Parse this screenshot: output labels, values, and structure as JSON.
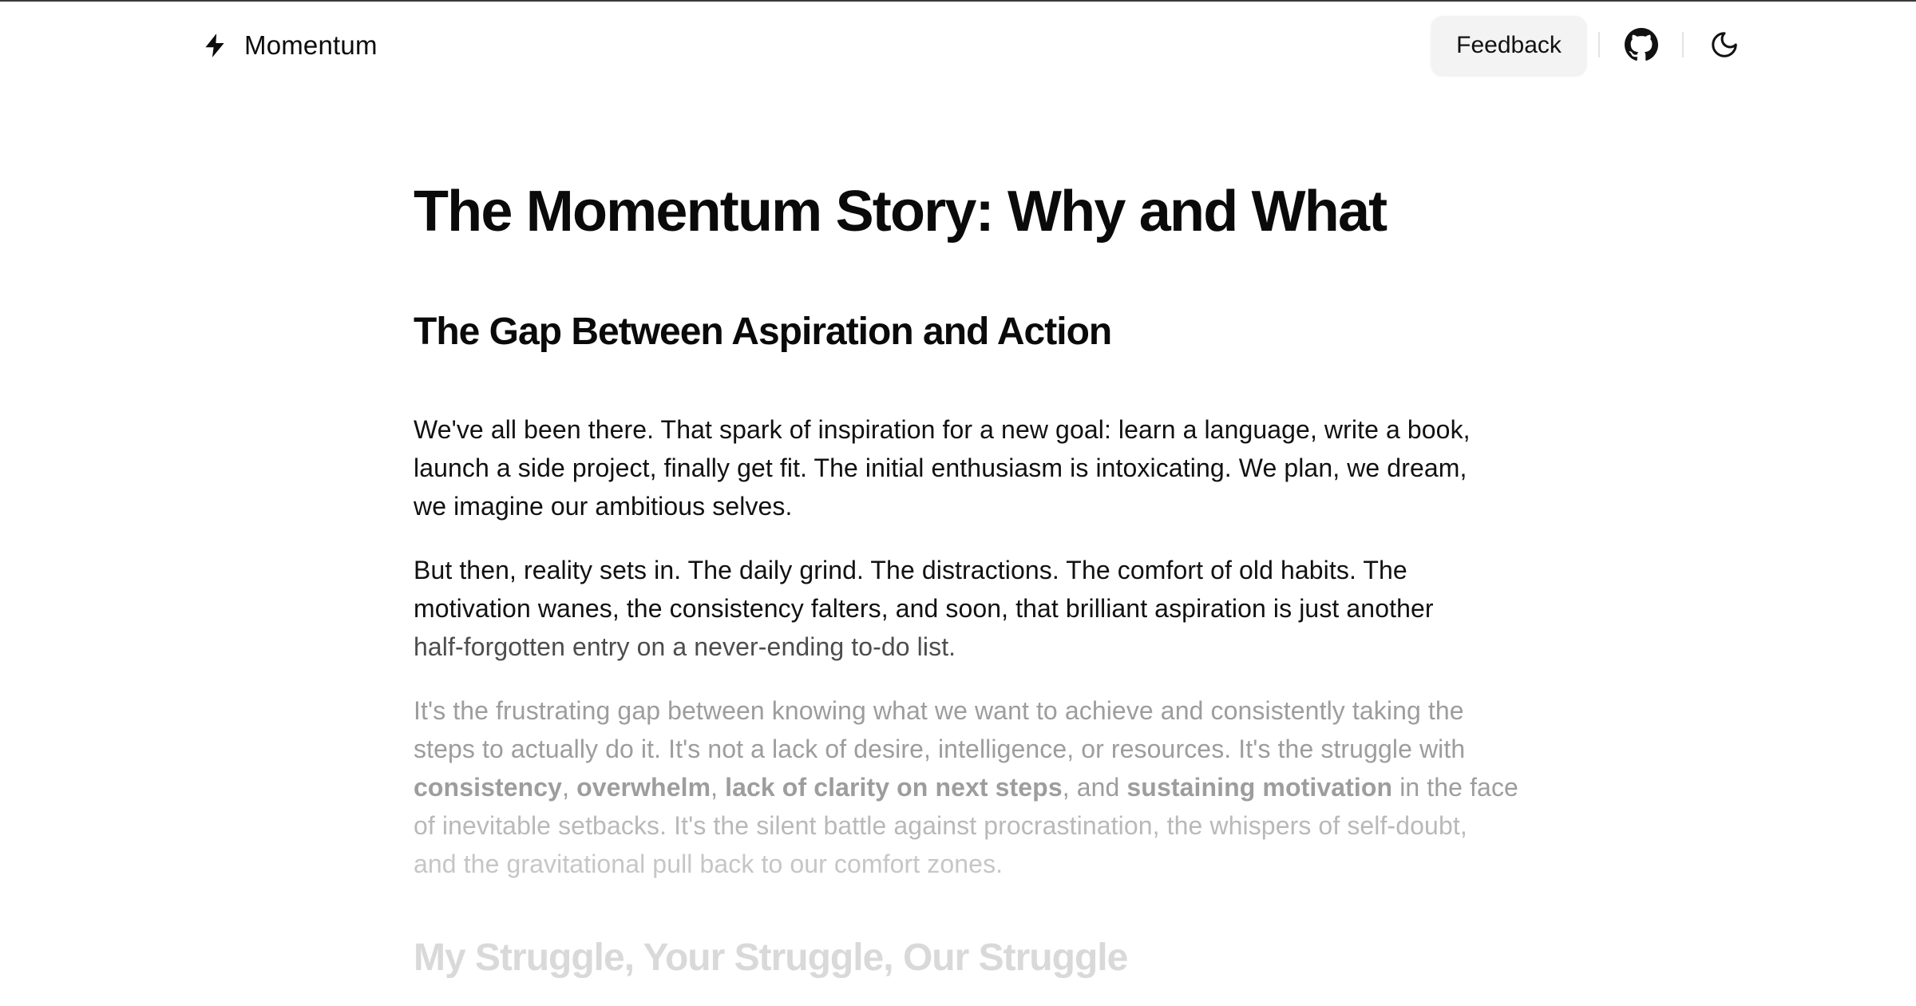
{
  "header": {
    "brand": {
      "name": "Momentum",
      "icon": "lightning-bolt-icon"
    },
    "feedback_label": "Feedback",
    "github_icon": "github-icon",
    "theme_icon": "moon-icon"
  },
  "article": {
    "title": "The Momentum Story: Why and What",
    "section1_heading": "The Gap Between Aspiration and Action",
    "p1": {
      "line1": "We've all been there. That spark of inspiration for a new goal: learn a language, write a book,",
      "line2": "launch a side project, finally get fit. The initial enthusiasm is intoxicating. We plan, we dream,",
      "line3": "we imagine our ambitious selves."
    },
    "p2": {
      "line1": "But then, reality sets in. The daily grind. The distractions. The comfort of old habits. The",
      "line2": "motivation wanes, the consistency falters, and soon, that brilliant aspiration is just another",
      "line3": "half-forgotten entry on a never-ending to-do list."
    },
    "p3": {
      "line1": "It's the frustrating gap between knowing what we want to achieve and consistently taking the",
      "line2": "steps to actually do it. It's not a lack of desire, intelligence, or resources. It's the struggle with",
      "line3": {
        "b1": "consistency",
        "s1": ", ",
        "b2": "overwhelm",
        "s2": ", ",
        "b3": "lack of clarity on next steps",
        "s3": ", and ",
        "b4": "sustaining motivation",
        "s4": " in the face"
      },
      "line4": "of inevitable setbacks. It's the silent battle against procrastination, the whispers of self-doubt,",
      "line5": "and the gravitational pull back to our comfort zones."
    },
    "section2_heading": "My Struggle, Your Struggle, Our Struggle"
  },
  "colors": {
    "text": "#0b0b0b",
    "feedback_bg": "#f3f3f3",
    "faded_text": "#9a9a9a"
  }
}
